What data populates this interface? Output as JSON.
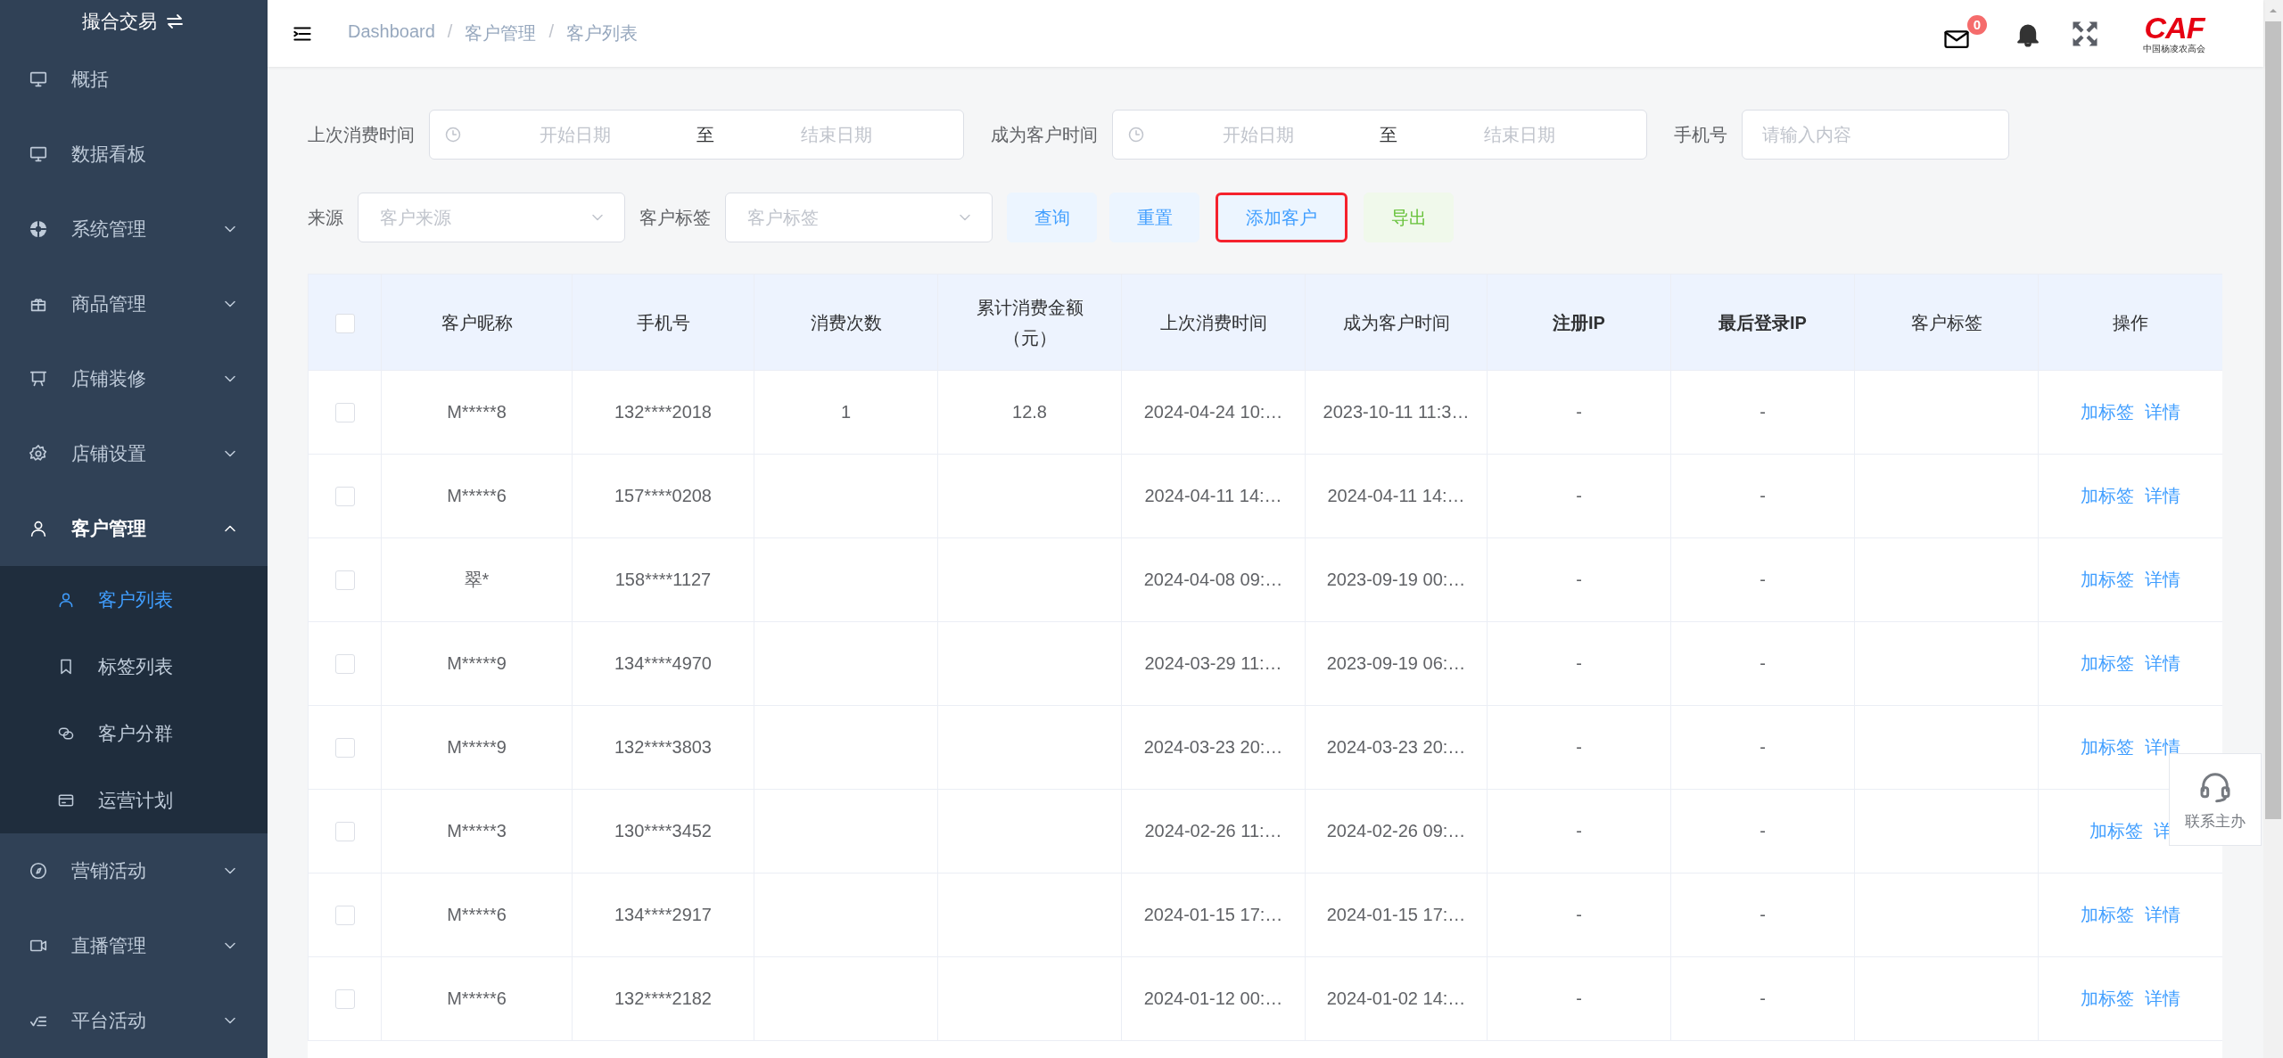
{
  "sidebar": {
    "title": "撮合交易",
    "items": [
      {
        "label": "概括",
        "kind": "link",
        "selected": false
      },
      {
        "label": "数据看板",
        "kind": "link",
        "selected": false
      },
      {
        "label": "系统管理",
        "kind": "group",
        "expanded": false,
        "selected": false
      },
      {
        "label": "商品管理",
        "kind": "group",
        "expanded": false,
        "selected": false
      },
      {
        "label": "店铺装修",
        "kind": "group",
        "expanded": false,
        "selected": false
      },
      {
        "label": "店铺设置",
        "kind": "group",
        "expanded": false,
        "selected": false
      },
      {
        "label": "客户管理",
        "kind": "group",
        "expanded": true,
        "selected": false,
        "children": [
          {
            "label": "客户列表",
            "selected": true
          },
          {
            "label": "标签列表",
            "selected": false
          },
          {
            "label": "客户分群",
            "selected": false
          },
          {
            "label": "运营计划",
            "selected": false
          }
        ]
      },
      {
        "label": "营销活动",
        "kind": "group",
        "expanded": false,
        "selected": false
      },
      {
        "label": "直播管理",
        "kind": "group",
        "expanded": false,
        "selected": false
      },
      {
        "label": "平台活动",
        "kind": "group",
        "expanded": false,
        "selected": false
      }
    ]
  },
  "header": {
    "breadcrumb": [
      "Dashboard",
      "客户管理",
      "客户列表"
    ],
    "separator": "/",
    "mail_badge": "0",
    "logo": {
      "mark": "CAF",
      "subtitle": "中国杨凌农高会"
    }
  },
  "filters": {
    "row_1": [
      {
        "kind": "daterange",
        "label": "上次消费时间",
        "start_placeholder": "开始日期",
        "separator": "至",
        "end_placeholder": "结束日期"
      },
      {
        "kind": "daterange",
        "label": "成为客户时间",
        "start_placeholder": "开始日期",
        "separator": "至",
        "end_placeholder": "结束日期"
      },
      {
        "kind": "input",
        "label": "手机号",
        "placeholder": "请输入内容"
      }
    ],
    "row_2": [
      {
        "kind": "select",
        "label": "来源",
        "placeholder": "客户来源"
      },
      {
        "kind": "select",
        "label": "客户标签",
        "placeholder": "客户标签"
      }
    ],
    "buttons": [
      {
        "label": "查询",
        "kind": "primary",
        "highlighted": false
      },
      {
        "label": "重置",
        "kind": "primary",
        "highlighted": false
      },
      {
        "label": "添加客户",
        "kind": "primary",
        "highlighted": true
      },
      {
        "label": "导出",
        "kind": "success",
        "highlighted": false
      }
    ]
  },
  "table": {
    "all_checked": false,
    "columns": [
      "客户昵称",
      "手机号",
      "消费次数",
      "累计消费金额（元）",
      "上次消费时间",
      "成为客户时间",
      "注册IP",
      "最后登录IP",
      "客户标签",
      "操作"
    ],
    "rows": [
      {
        "checked": false,
        "nickname": "M*****8",
        "phone": "132****2018",
        "count": "1",
        "amount": "12.8",
        "last_purchase": "2024-04-24 10:…",
        "became_customer": "2023-10-11 11:3…",
        "register_ip": "-",
        "last_login_ip": "-",
        "actions": [
          "加标签",
          "详情"
        ]
      },
      {
        "checked": false,
        "nickname": "M*****6",
        "phone": "157****0208",
        "last_purchase": "2024-04-11 14:…",
        "became_customer": "2024-04-11 14:…",
        "register_ip": "-",
        "last_login_ip": "-",
        "actions": [
          "加标签",
          "详情"
        ]
      },
      {
        "checked": false,
        "nickname": "翠*",
        "phone": "158****1127",
        "last_purchase": "2024-04-08 09:…",
        "became_customer": "2023-09-19 00:…",
        "register_ip": "-",
        "last_login_ip": "-",
        "actions": [
          "加标签",
          "详情"
        ]
      },
      {
        "checked": false,
        "nickname": "M*****9",
        "phone": "134****4970",
        "last_purchase": "2024-03-29 11:…",
        "became_customer": "2023-09-19 06:…",
        "register_ip": "-",
        "last_login_ip": "-",
        "actions": [
          "加标签",
          "详情"
        ]
      },
      {
        "checked": false,
        "nickname": "M*****9",
        "phone": "132****3803",
        "last_purchase": "2024-03-23 20:…",
        "became_customer": "2024-03-23 20:…",
        "register_ip": "-",
        "last_login_ip": "-",
        "actions": [
          "加标签",
          "详情"
        ]
      },
      {
        "checked": false,
        "nickname": "M*****3",
        "phone": "130****3452",
        "last_purchase": "2024-02-26 11:…",
        "became_customer": "2024-02-26 09:…",
        "register_ip": "-",
        "last_login_ip": "-",
        "actions": [
          "加标签",
          "详"
        ]
      },
      {
        "checked": false,
        "nickname": "M*****6",
        "phone": "134****2917",
        "last_purchase": "2024-01-15 17:…",
        "became_customer": "2024-01-15 17:…",
        "register_ip": "-",
        "last_login_ip": "-",
        "actions": [
          "加标签",
          "详情"
        ]
      },
      {
        "checked": false,
        "nickname": "M*****6",
        "phone": "132****2182",
        "last_purchase": "2024-01-12 00:…",
        "became_customer": "2024-01-02 14:…",
        "register_ip": "-",
        "last_login_ip": "-",
        "actions": [
          "加标签",
          "详情"
        ]
      }
    ]
  },
  "contact": {
    "label": "联系主办"
  }
}
